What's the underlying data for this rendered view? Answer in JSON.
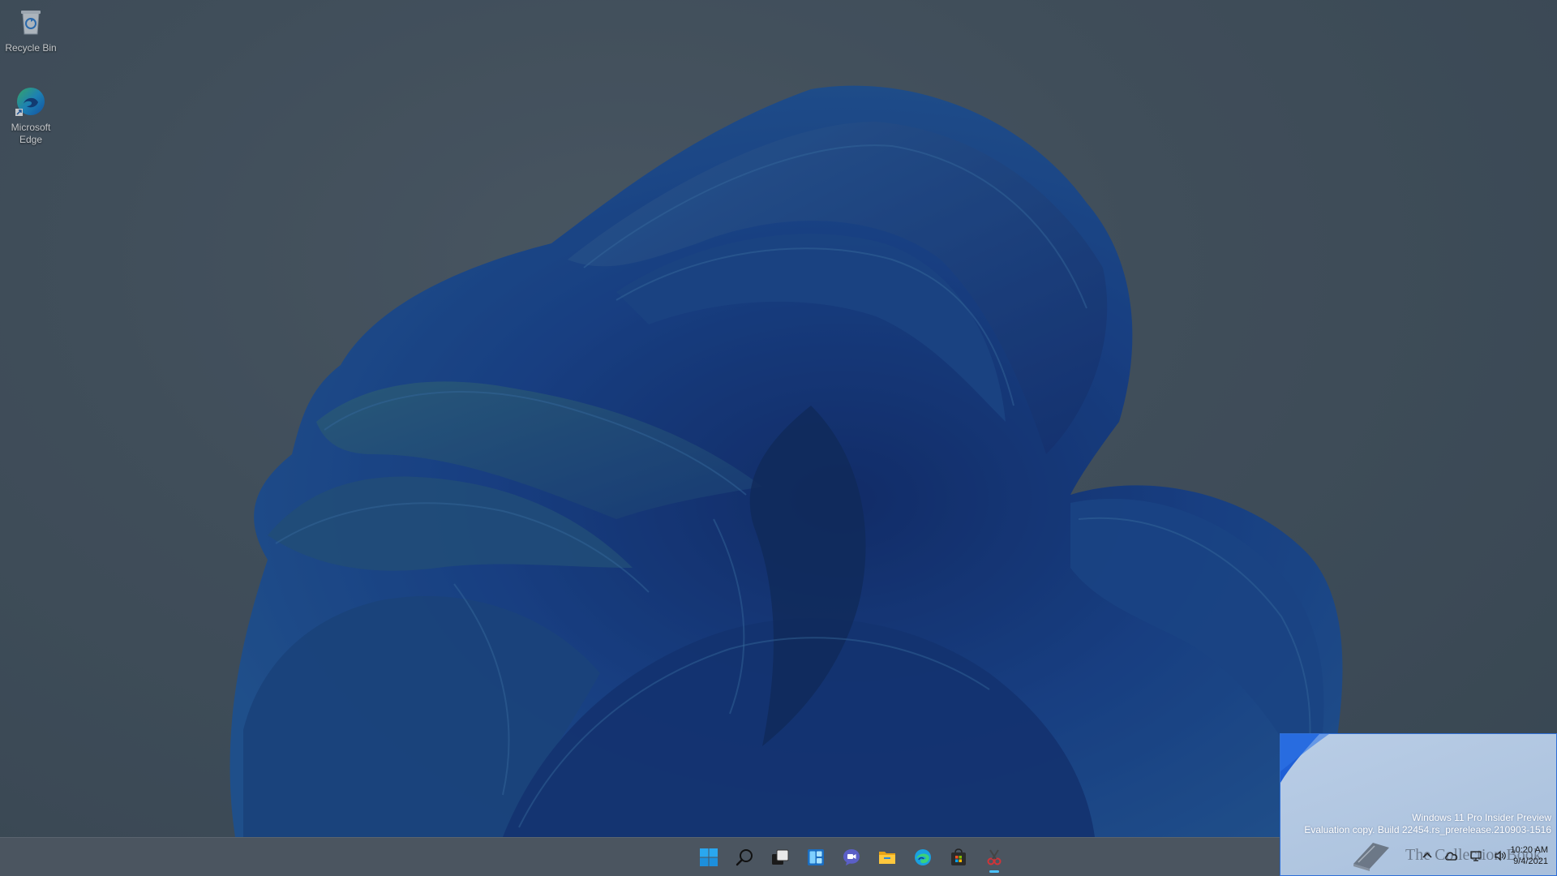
{
  "desktop": {
    "icons": [
      {
        "label": "Recycle Bin",
        "icon": "recycle-bin-icon"
      },
      {
        "label": "Microsoft Edge",
        "icon": "edge-icon"
      }
    ]
  },
  "taskbar": {
    "apps": [
      {
        "name": "Start",
        "icon": "windows-start-icon"
      },
      {
        "name": "Search",
        "icon": "search-icon"
      },
      {
        "name": "Task View",
        "icon": "task-view-icon"
      },
      {
        "name": "Widgets",
        "icon": "widgets-icon"
      },
      {
        "name": "Chat",
        "icon": "chat-icon"
      },
      {
        "name": "File Explorer",
        "icon": "file-explorer-icon"
      },
      {
        "name": "Microsoft Edge",
        "icon": "edge-icon"
      },
      {
        "name": "Microsoft Store",
        "icon": "store-icon"
      },
      {
        "name": "Snipping Tool",
        "icon": "snipping-tool-icon"
      }
    ],
    "tray": {
      "time": "10:20 AM",
      "date": "9/4/2021"
    }
  },
  "watermark": {
    "line1": "Windows 11 Pro Insider Preview",
    "line2": "Evaluation copy. Build 22454.rs_prerelease.210903-1516",
    "logo_text": "The Collection Book"
  },
  "colors": {
    "accent": "#4cc2ff",
    "wallpaper_blue": "#1a4a9a",
    "taskbar": "#4b5560"
  }
}
